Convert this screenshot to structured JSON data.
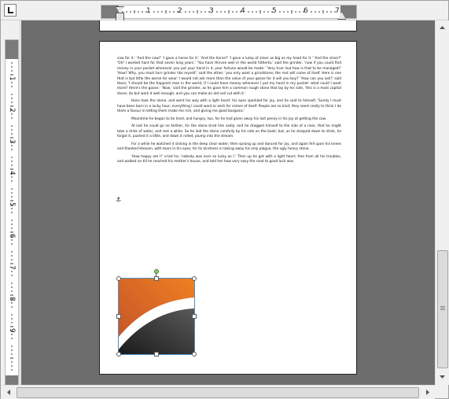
{
  "ruler": {
    "horizontal_numbers": [
      "1",
      "2",
      "3",
      "4",
      "5",
      "6",
      "7"
    ],
    "vertical_numbers": [
      "1",
      "2",
      "3",
      "4",
      "5",
      "6",
      "7",
      "8",
      "9"
    ]
  },
  "document": {
    "paragraphs": [
      "cow for it.' 'And the cow?' 'I gave a horse for it.' 'And the horse?' 'I gave a lump of silver as big as my head for it.' 'And the silver?' 'Oh! I worked hard for that seven long years.' 'You have thriven well in the world hitherto,' said the grinder, 'now if you could find money in your pocket whenever you put your hand in it, your fortune would be made.' 'Very true: but how is that to be managed?' 'How? Why, you must turn grinder like myself,' said the other; 'you only want a grindstone; the rest will come of itself. Here is one that is but little the worse for wear: I would not ask more than the value of your goose for it will you buy?' 'How can you ask?' said Hans; 'I should be the happiest man in the world, if I could have money whenever I put my hand in my pocket: what could I want more? there's the goose.' 'Now,' said the grinder, as he gave him a common rough stone that lay by his side, 'this is a most capital stone; do but work it well enough, and you can make an old nail cut with it.'",
      "Hans took the stone, and went his way with a light heart: his eyes sparkled for joy, and he said to himself, 'Surely I must have been born in a lucky hour; everything I could want or wish for comes of itself. People are so kind; they seem really to think I do them a favour in letting them make me rich, and giving me good bargains.'",
      "Meantime he began to be tired, and hungry, too, for he had given away his last penny in his joy at getting the cow.",
      "At last he could go no farther, for the stone tired him sadly: and he dragged himself to the side of a river, that he might take a drink of water, and rest a while. So he laid the stone carefully by his side on the bank: but, as he stooped down to drink, he forgot it, pushed it a little, and down it rolled, plump into the stream.",
      "For a while he watched it sinking in the deep clear water; then sprang up and danced for joy, and again fell upon his knees and thanked Heaven, with tears in his eyes, for its kindness in taking away his only plague, the ugly heavy stone.",
      "'How happy am I!' cried he; 'nobody was ever so lucky as I.' Then up he got with a light heart, free from all his troubles, and walked on till he reached his mother's house, and told her how very easy the road to good luck was."
    ],
    "anchor_symbol": "⚓"
  },
  "image": {
    "colors": {
      "orange_top": "#f08020",
      "orange_bottom": "#c0502a",
      "swoosh": "#ffffff",
      "dark": "#1a1a1a",
      "dark_light": "#5a5a5a"
    }
  },
  "colors": {
    "workspace": "#6d6d6d",
    "page": "#ffffff",
    "ruler_margin": "#7a7a7a",
    "selection": "#4a90c8",
    "rotate_handle": "#8fcf6a"
  }
}
